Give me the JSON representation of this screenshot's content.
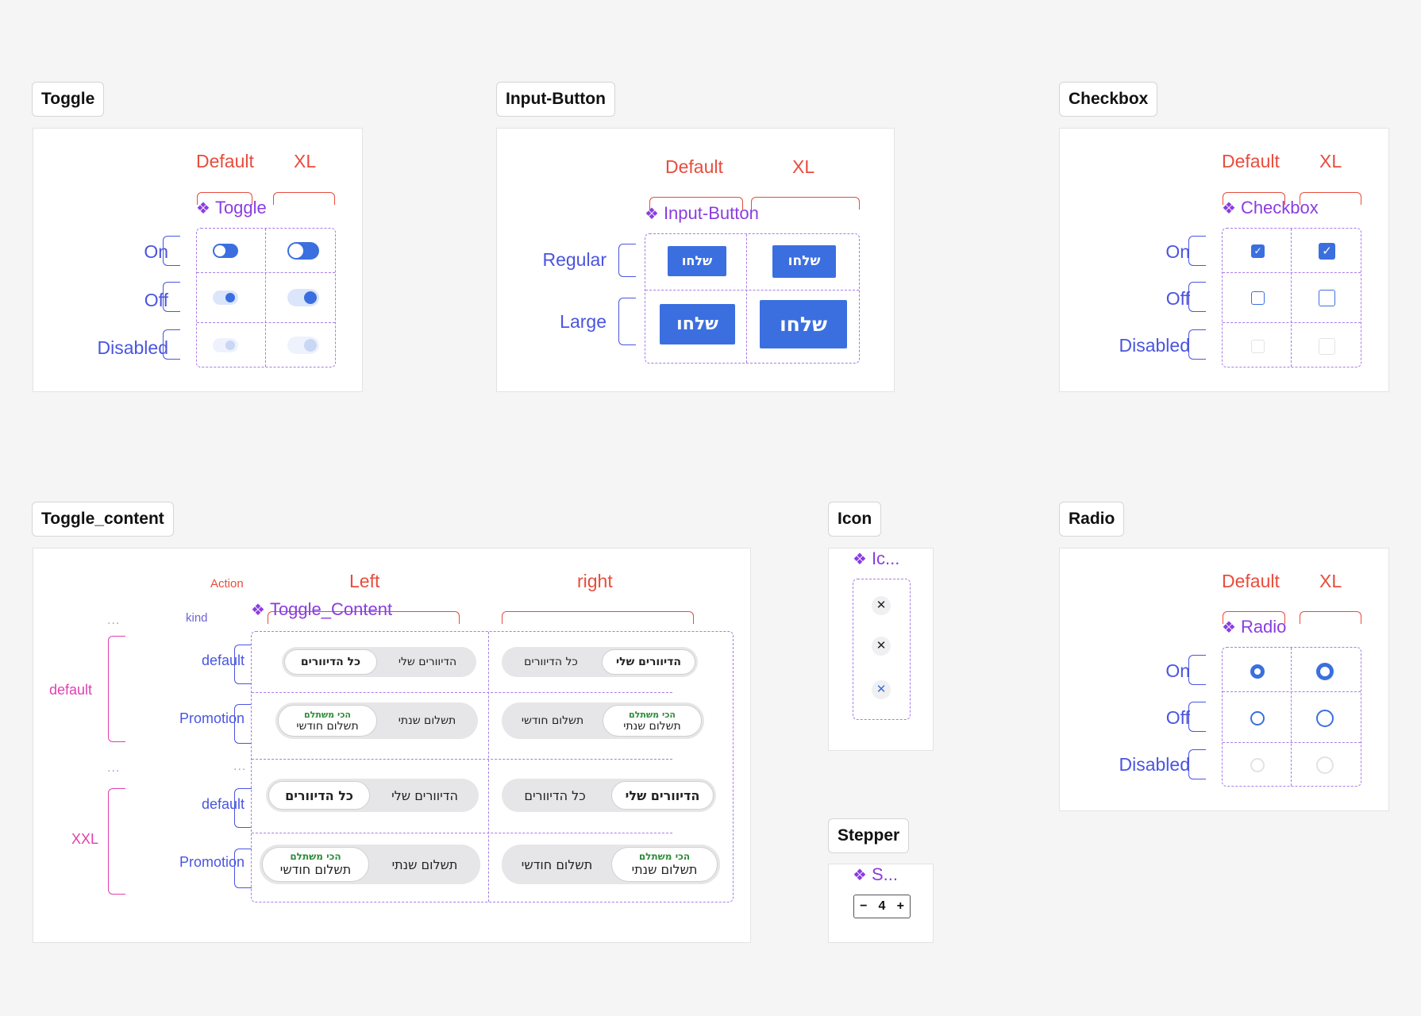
{
  "toggle": {
    "title": "Toggle",
    "col_default": "Default",
    "col_xl": "XL",
    "component": "Toggle",
    "rows": [
      "On",
      "Off",
      "Disabled"
    ]
  },
  "input_button": {
    "title": "Input-Button",
    "col_default": "Default",
    "col_xl": "XL",
    "component": "Input-Button",
    "rows": [
      "Regular",
      "Large"
    ],
    "button_label": "שלחו"
  },
  "checkbox": {
    "title": "Checkbox",
    "col_default": "Default",
    "col_xl": "XL",
    "component": "Checkbox",
    "rows": [
      "On",
      "Off",
      "Disabled"
    ],
    "check_glyph": "✓"
  },
  "toggle_content": {
    "title": "Toggle_content",
    "action_label": "Action",
    "col_left": "Left",
    "col_right": "right",
    "component": "Toggle_Content",
    "kind_label": "kind",
    "ellipsis": "...",
    "group_default": "default",
    "group_xxl": "XXL",
    "row_default": "default",
    "row_promotion": "Promotion",
    "all_residents": "כל הדיוורים",
    "my_residents": "הדיוורים שלי",
    "promo_tag": "הכי משתלם",
    "monthly": "תשלום חודשי",
    "yearly": "תשלום שנתי"
  },
  "icon": {
    "title": "Icon",
    "component": "Ic...",
    "glyph": "✕"
  },
  "stepper": {
    "title": "Stepper",
    "component": "S...",
    "minus": "−",
    "value": "4",
    "plus": "+"
  },
  "radio": {
    "title": "Radio",
    "col_default": "Default",
    "col_xl": "XL",
    "component": "Radio",
    "rows": [
      "On",
      "Off",
      "Disabled"
    ]
  },
  "colors": {
    "background": "#f5f5f5",
    "accent_blue": "#3b6fe0",
    "label_blue": "#4a55e0",
    "header_red": "#e84c3d",
    "component_purple": "#8a3de0",
    "group_pink": "#e040b0",
    "promo_green": "#2e8b3a"
  },
  "icons": {
    "component_marker": "four-diamond-component-icon",
    "close": "close-x-icon"
  }
}
